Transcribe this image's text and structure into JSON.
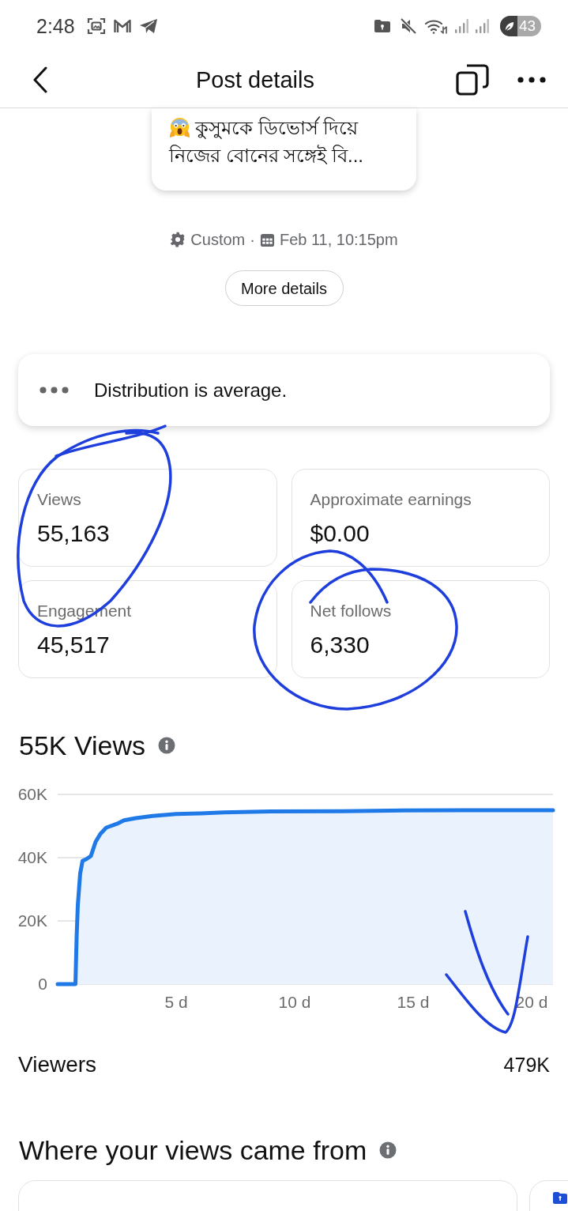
{
  "status_bar": {
    "time": "2:48",
    "battery": "43"
  },
  "header": {
    "title": "Post details"
  },
  "post_preview": {
    "lines": [
      "কুসুমকে ডিভোর্স দিয়ে",
      "নিজের বোনের সঙ্গেই বি..."
    ]
  },
  "meta": {
    "audience": "Custom",
    "separator": "·",
    "date": "Feb 11, 10:15pm"
  },
  "more_details_button": "More details",
  "distribution": {
    "text": "Distribution is average."
  },
  "stats": [
    {
      "label": "Views",
      "value": "55,163"
    },
    {
      "label": "Approximate earnings",
      "value": "$0.00"
    },
    {
      "label": "Engagement",
      "value": "45,517"
    },
    {
      "label": "Net follows",
      "value": "6,330"
    }
  ],
  "views_chart": {
    "title": "55K Views",
    "chart_data": {
      "type": "line",
      "x": [
        0,
        0.75,
        0.8,
        0.85,
        0.95,
        1.05,
        1.2,
        1.4,
        1.6,
        1.8,
        2.05,
        2.5,
        2.8,
        3.3,
        4,
        5,
        6,
        7,
        9,
        12,
        14,
        17,
        20.9
      ],
      "series": [
        {
          "color": "#1f7ae8",
          "values": [
            0,
            0,
            15000,
            25000,
            35000,
            39000,
            39500,
            40500,
            45000,
            47500,
            49500,
            50700,
            51800,
            52500,
            53200,
            53800,
            54000,
            54300,
            54600,
            54700,
            54900,
            55000,
            55000
          ]
        }
      ],
      "xlim": [
        0,
        20.9
      ],
      "ylim": [
        0,
        60000
      ],
      "xticks": [
        {
          "value": 5,
          "label": "5 d"
        },
        {
          "value": 10,
          "label": "10 d"
        },
        {
          "value": 15,
          "label": "15 d"
        },
        {
          "value": 20,
          "label": "20 d"
        }
      ],
      "yticks": [
        {
          "value": 0,
          "label": "0"
        },
        {
          "value": 20000,
          "label": "20K"
        },
        {
          "value": 40000,
          "label": "40K"
        },
        {
          "value": 60000,
          "label": "60K"
        }
      ]
    }
  },
  "viewers": {
    "label": "Viewers",
    "value": "479K"
  },
  "sources": {
    "title": "Where your views came from"
  }
}
